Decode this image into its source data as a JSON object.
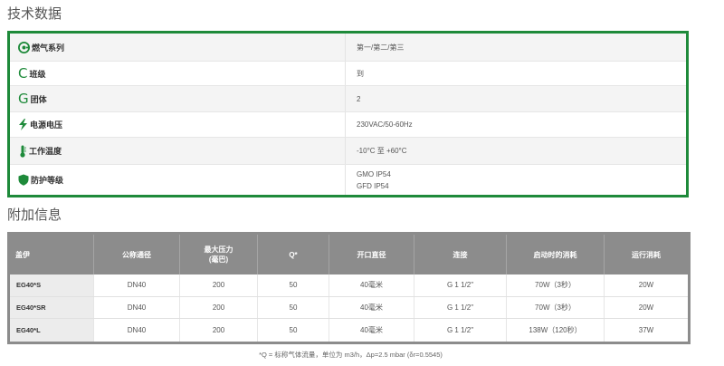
{
  "sections": {
    "tech_title": "技术数据",
    "extra_title": "附加信息"
  },
  "colors": {
    "accent": "#1e8a3a",
    "table_header": "#8c8c8c"
  },
  "specs": [
    {
      "label": "燃气系列",
      "icon": "gas-series-icon",
      "values": [
        "第一/第二/第三"
      ]
    },
    {
      "label": "班级",
      "icon": "class-letter-c-icon",
      "values": [
        "到"
      ]
    },
    {
      "label": "团体",
      "icon": "group-letter-g-icon",
      "values": [
        "2"
      ]
    },
    {
      "label": "电源电压",
      "icon": "lightning-bolt-icon",
      "values": [
        "230VAC/50-60Hz"
      ]
    },
    {
      "label": "工作温度",
      "icon": "thermometer-icon",
      "values": [
        "-10°C 至 +60°C"
      ]
    },
    {
      "label": "防护等级",
      "icon": "shield-icon",
      "values": [
        "GMO IP54",
        "GFD IP54"
      ]
    }
  ],
  "table": {
    "headers": [
      "盖伊",
      "公称通径",
      "最大压力\n(毫巴)",
      "Q*",
      "开口直径",
      "连接",
      "启动时的消耗",
      "运行消耗"
    ],
    "rows": [
      [
        "EG40*S",
        "DN40",
        "200",
        "50",
        "40毫米",
        "G 1 1/2\"",
        "70W（3秒）",
        "20W"
      ],
      [
        "EG40*SR",
        "DN40",
        "200",
        "50",
        "40毫米",
        "G 1 1/2\"",
        "70W（3秒）",
        "20W"
      ],
      [
        "EG40*L",
        "DN40",
        "200",
        "50",
        "40毫米",
        "G 1 1/2\"",
        "138W（120秒）",
        "37W"
      ]
    ]
  },
  "footnote": "*Q = 标称气体流量，单位为 m3/h，Δp=2.5 mbar (δr=0.5545)"
}
